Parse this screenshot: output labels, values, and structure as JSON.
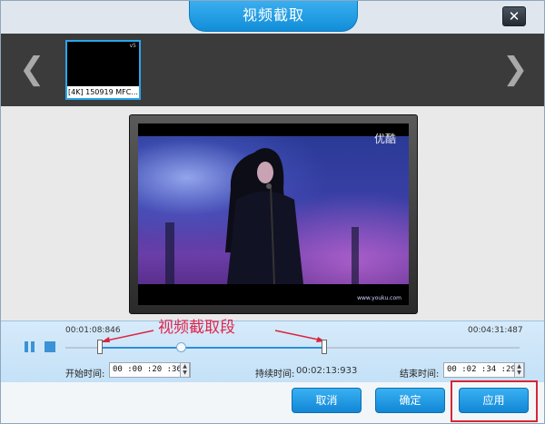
{
  "window": {
    "title": "视频截取",
    "close_label": "✕"
  },
  "thumbnails": [
    {
      "label": "[4K] 150919 MFC...",
      "badge": "v5",
      "selected": true
    }
  ],
  "nav": {
    "prev_icon": "chevron-left-icon",
    "next_icon": "chevron-right-icon",
    "prev_glyph": "❮",
    "next_glyph": "❯"
  },
  "preview": {
    "watermark": "优酷",
    "corner_text": "www.youku.com"
  },
  "timeline": {
    "start_time": "00:01:08:846",
    "end_time": "00:04:31:487",
    "annotation": "视频截取段",
    "selection_start_fraction": 0.076,
    "selection_end_fraction": 0.57,
    "playhead_fraction": 0.25
  },
  "fields": {
    "start_label": "开始时间:",
    "start_value": "00 :00 :20 :362",
    "duration_label": "持续时间:",
    "duration_value": "00:02:13:933",
    "end_label": "结束时间:",
    "end_value": "00 :02 :34 :295"
  },
  "buttons": {
    "cancel": "取消",
    "ok": "确定",
    "apply": "应用"
  },
  "colors": {
    "accent": "#1a96e0",
    "highlight": "#d62635",
    "annotation": "#e0254a"
  }
}
